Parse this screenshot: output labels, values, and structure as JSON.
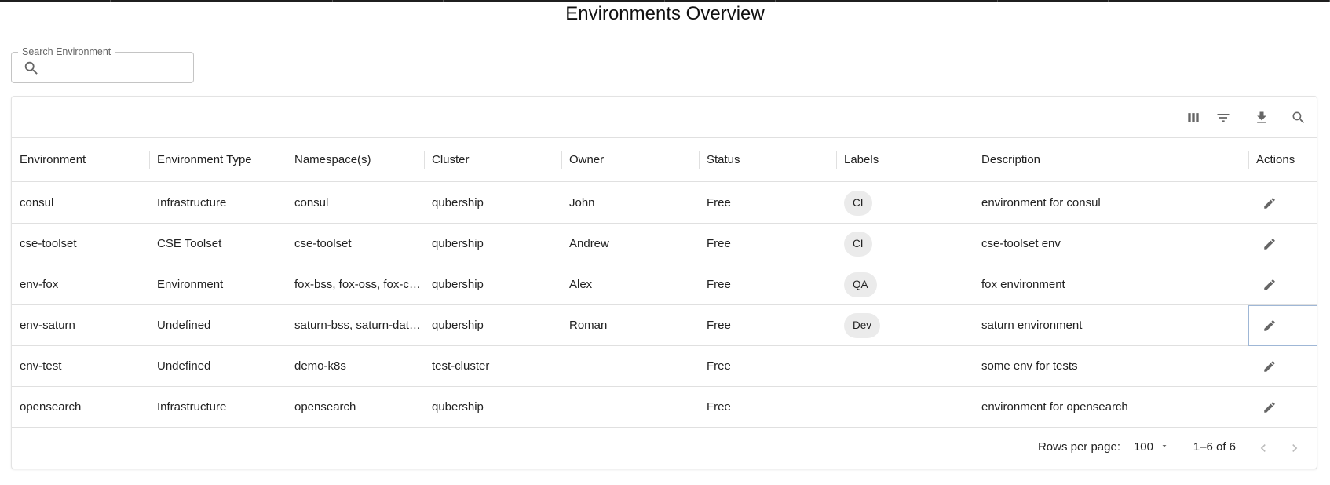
{
  "page": {
    "title": "Environments Overview"
  },
  "search": {
    "label": "Search Environment",
    "value": "",
    "placeholder": ""
  },
  "toolbar": {
    "icons": [
      "view-columns-icon",
      "filter-icon",
      "download-icon",
      "search-icon"
    ]
  },
  "table": {
    "columns": [
      "Environment",
      "Environment Type",
      "Namespace(s)",
      "Cluster",
      "Owner",
      "Status",
      "Labels",
      "Description",
      "Actions"
    ],
    "rows": [
      {
        "environment": "consul",
        "type": "Infrastructure",
        "namespaces": "consul",
        "cluster": "qubership",
        "owner": "John",
        "status": "Free",
        "label": "CI",
        "description": "environment for consul"
      },
      {
        "environment": "cse-toolset",
        "type": "CSE Toolset",
        "namespaces": "cse-toolset",
        "cluster": "qubership",
        "owner": "Andrew",
        "status": "Free",
        "label": "CI",
        "description": "cse-toolset env"
      },
      {
        "environment": "env-fox",
        "type": "Environment",
        "namespaces": "fox-bss, fox-oss, fox-c…",
        "cluster": "qubership",
        "owner": "Alex",
        "status": "Free",
        "label": "QA",
        "description": "fox environment"
      },
      {
        "environment": "env-saturn",
        "type": "Undefined",
        "namespaces": "saturn-bss, saturn-dat…",
        "cluster": "qubership",
        "owner": "Roman",
        "status": "Free",
        "label": "Dev",
        "description": "saturn environment"
      },
      {
        "environment": "env-test",
        "type": "Undefined",
        "namespaces": "demo-k8s",
        "cluster": "test-cluster",
        "owner": "",
        "status": "Free",
        "label": "",
        "description": "some env for tests"
      },
      {
        "environment": "opensearch",
        "type": "Infrastructure",
        "namespaces": "opensearch",
        "cluster": "qubership",
        "owner": "",
        "status": "Free",
        "label": "",
        "description": "environment for opensearch"
      }
    ]
  },
  "pagination": {
    "rows_per_page_label": "Rows per page:",
    "rows_per_page": "100",
    "range": "1–6 of 6"
  },
  "colors": {
    "icon": "#666666",
    "chip_bg": "#ebebeb",
    "border": "#e0e0e0",
    "focus": "#9fb7d6"
  }
}
